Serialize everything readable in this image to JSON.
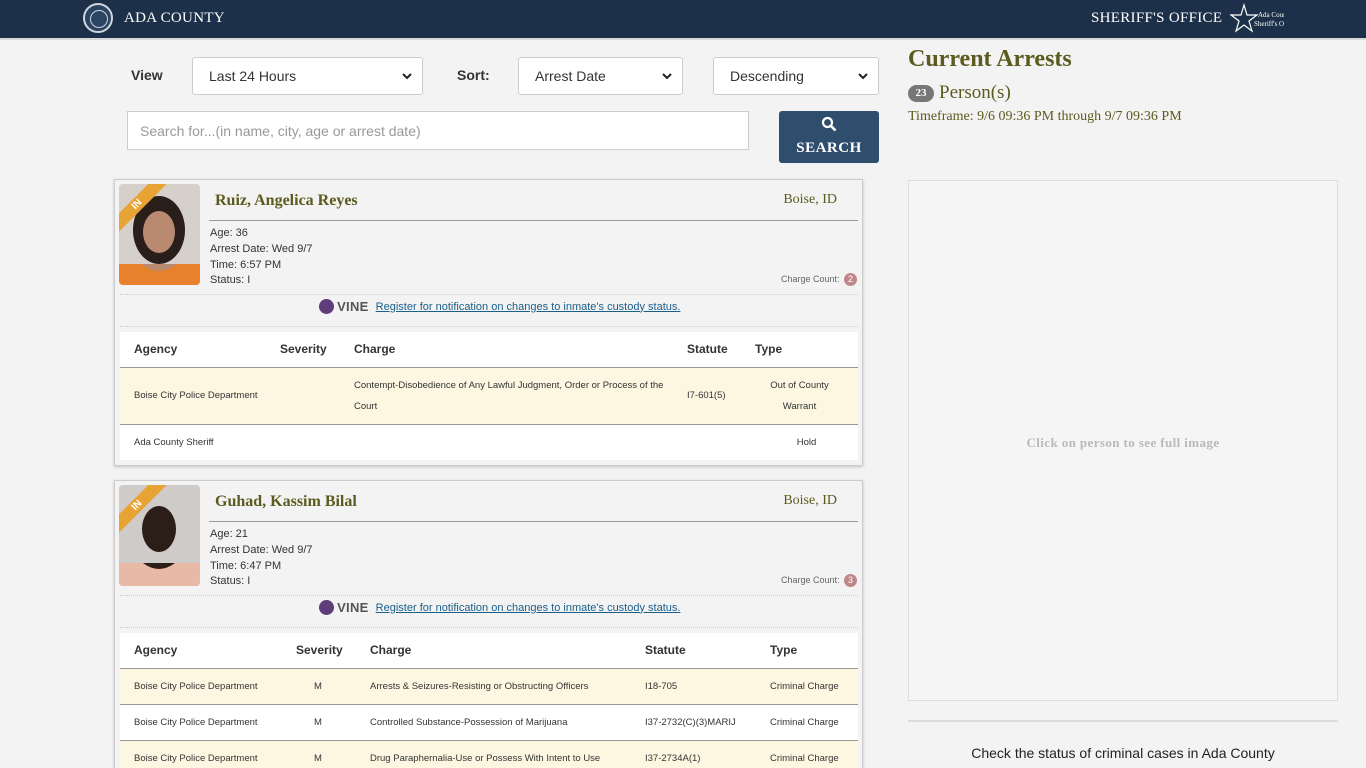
{
  "header": {
    "county": "ADA COUNTY",
    "office": "SHERIFF'S OFFICE",
    "logo_text": "Ada County Sheriff's Office"
  },
  "controls": {
    "view_label": "View",
    "view_value": "Last 24 Hours",
    "sort_label": "Sort:",
    "sort_value": "Arrest Date",
    "order_value": "Descending",
    "search_placeholder": "Search for...(in name, city, age or arrest date)",
    "search_button": "SEARCH"
  },
  "summary": {
    "title": "Current Arrests",
    "count": "23",
    "persons_label": "Person(s)",
    "timeframe": "Timeframe: 9/6 09:36 PM through 9/7 09:36 PM",
    "image_hint": "Click on person to see full image",
    "check_status": "Check the status of criminal cases in Ada County"
  },
  "vine": {
    "word": "VINE",
    "link": "Register for notification on changes to inmate's custody status."
  },
  "inmates": [
    {
      "ribbon": "IN",
      "name": "Ruiz, Angelica Reyes",
      "city": "Boise, ID",
      "age": "Age: 36",
      "arrest_date": "Arrest Date: Wed 9/7",
      "time": "Time: 6:57 PM",
      "status": "Status: I",
      "charge_count_label": "Charge Count:",
      "charge_count": "2",
      "headers": [
        "Agency",
        "Severity",
        "Charge",
        "Statute",
        "Type"
      ],
      "charges": [
        {
          "agency": "Boise City Police Department",
          "severity": "",
          "charge": "Contempt-Disobedience of Any Lawful Judgment, Order or Process of the Court",
          "statute": "I7-601(5)",
          "type": "Out of County Warrant"
        },
        {
          "agency": "Ada County Sheriff",
          "severity": "",
          "charge": "",
          "statute": "",
          "type": "Hold"
        }
      ]
    },
    {
      "ribbon": "IN",
      "name": "Guhad, Kassim Bilal",
      "city": "Boise, ID",
      "age": "Age: 21",
      "arrest_date": "Arrest Date: Wed 9/7",
      "time": "Time: 6:47 PM",
      "status": "Status: I",
      "charge_count_label": "Charge Count:",
      "charge_count": "3",
      "headers": [
        "Agency",
        "Severity",
        "Charge",
        "Statute",
        "Type"
      ],
      "charges": [
        {
          "agency": "Boise City Police Department",
          "severity": "M",
          "charge": "Arrests & Seizures-Resisting or Obstructing Officers",
          "statute": "I18-705",
          "type": "Criminal Charge"
        },
        {
          "agency": "Boise City Police Department",
          "severity": "M",
          "charge": "Controlled Substance-Possession of Marijuana",
          "statute": "I37-2732(C)(3)MARIJ",
          "type": "Criminal Charge"
        },
        {
          "agency": "Boise City Police Department",
          "severity": "M",
          "charge": "Drug Paraphernalia-Use or Possess With Intent to Use",
          "statute": "I37-2734A(1)",
          "type": "Criminal Charge"
        }
      ]
    }
  ]
}
